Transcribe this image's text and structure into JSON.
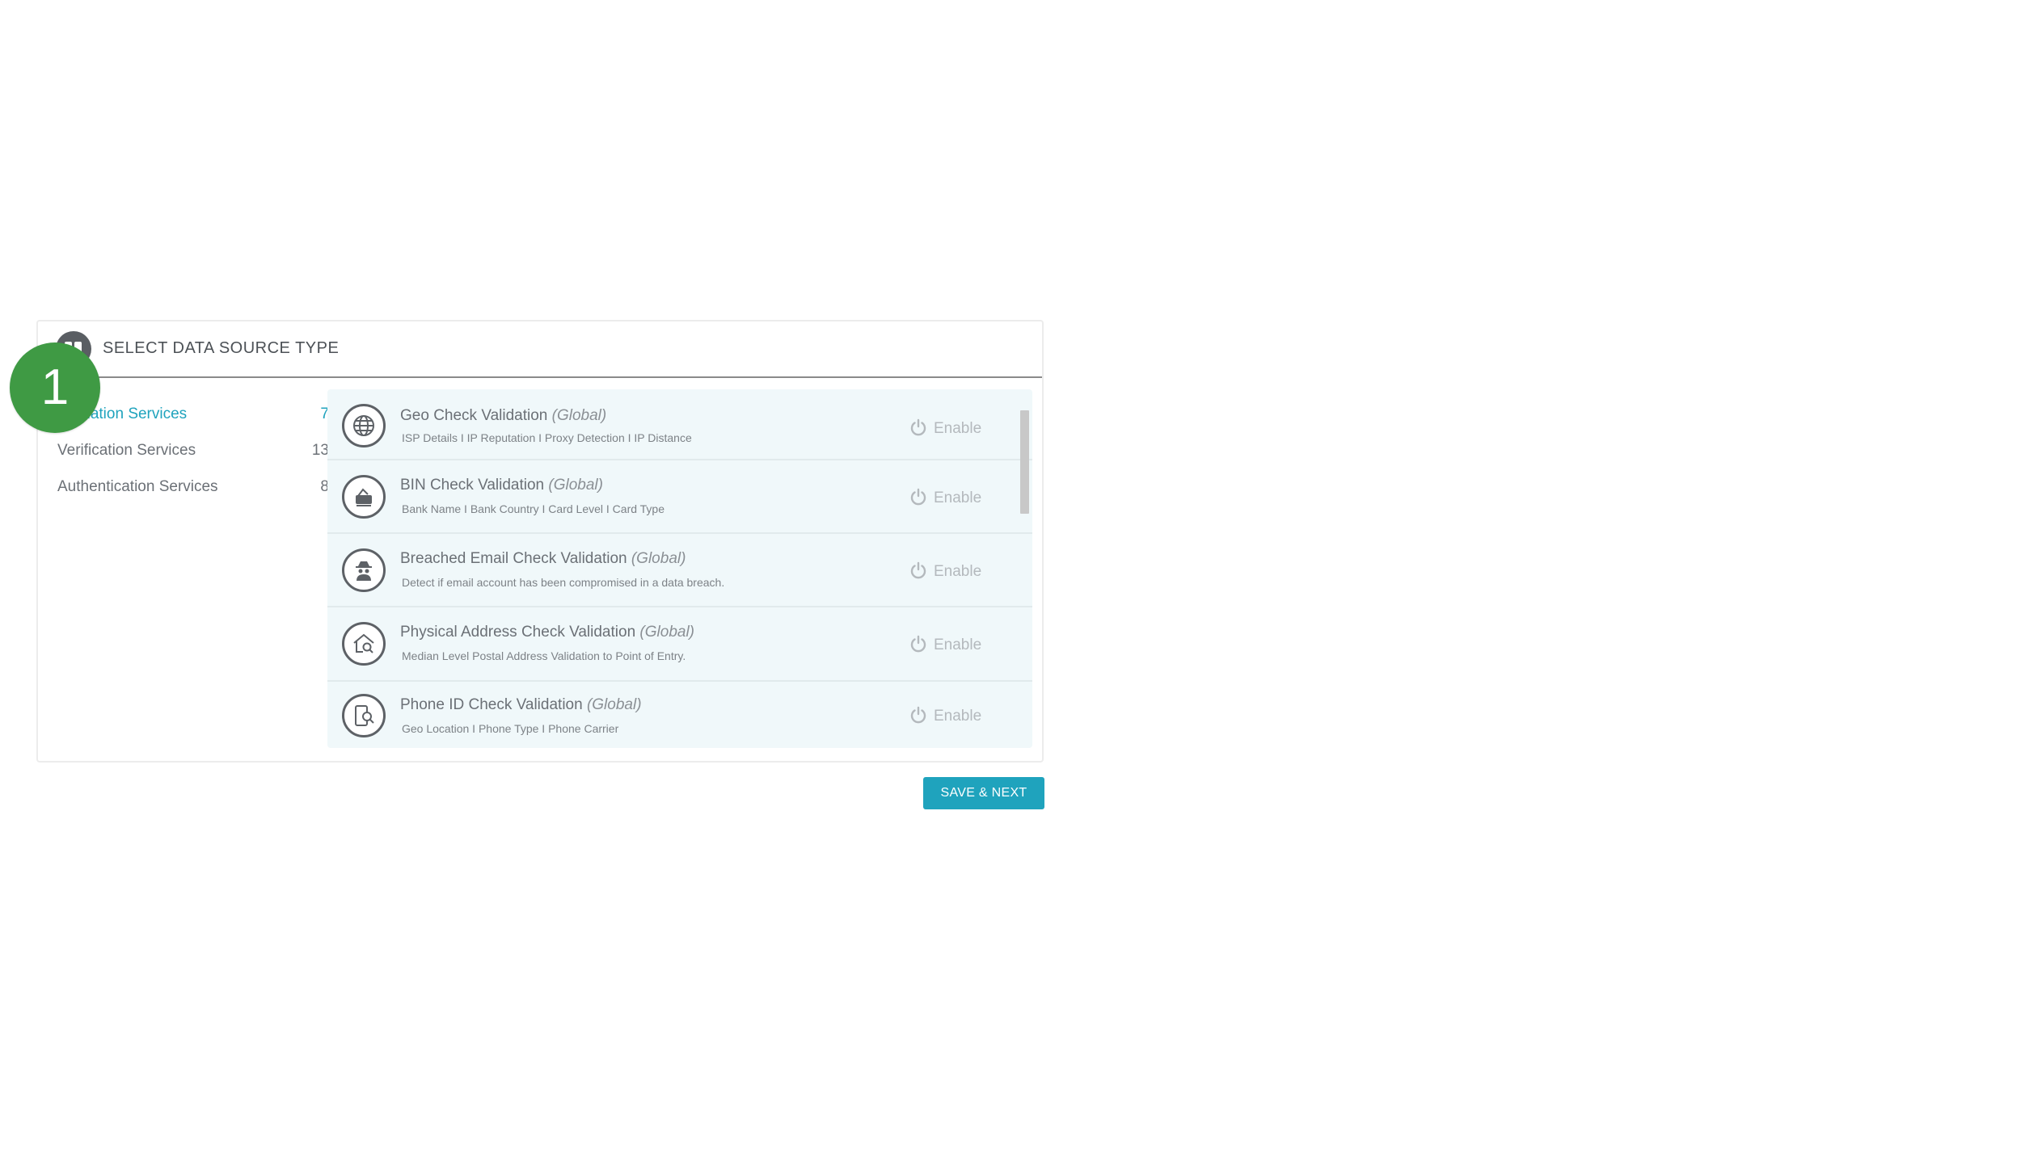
{
  "panel": {
    "title": "SELECT DATA SOURCE TYPE",
    "header_icon": "data-source-icon"
  },
  "step_badge": "1",
  "categories": [
    {
      "label": "Validation Services",
      "count": "7",
      "active": true
    },
    {
      "label": "Verification Services",
      "count": "13",
      "active": false
    },
    {
      "label": "Authentication Services",
      "count": "8",
      "active": false
    }
  ],
  "services": [
    {
      "name": "Geo Check Validation",
      "scope": "(Global)",
      "description": "ISP Details  I  IP Reputation  I  Proxy Detection  I  IP Distance",
      "icon": "globe-icon",
      "action": "Enable"
    },
    {
      "name": "BIN Check Validation",
      "scope": "(Global)",
      "description": "Bank Name  I  Bank Country  I  Card Level  I  Card Type",
      "icon": "card-icon",
      "action": "Enable"
    },
    {
      "name": "Breached Email Check Validation",
      "scope": "(Global)",
      "description": "Detect if email account has been compromised in a data breach.",
      "icon": "spy-icon",
      "action": "Enable"
    },
    {
      "name": "Physical Address Check Validation",
      "scope": "(Global)",
      "description": "Median Level Postal Address Validation to Point of Entry.",
      "icon": "house-search-icon",
      "action": "Enable"
    },
    {
      "name": "Phone ID Check Validation",
      "scope": "(Global)",
      "description": "Geo Location  I  Phone Type  I  Phone Carrier",
      "icon": "phone-search-icon",
      "action": "Enable"
    }
  ],
  "save_button": "SAVE & NEXT",
  "colors": {
    "accent": "#1fa3bd",
    "badge": "#3f9a44",
    "list_background": "#f0f8fa"
  }
}
